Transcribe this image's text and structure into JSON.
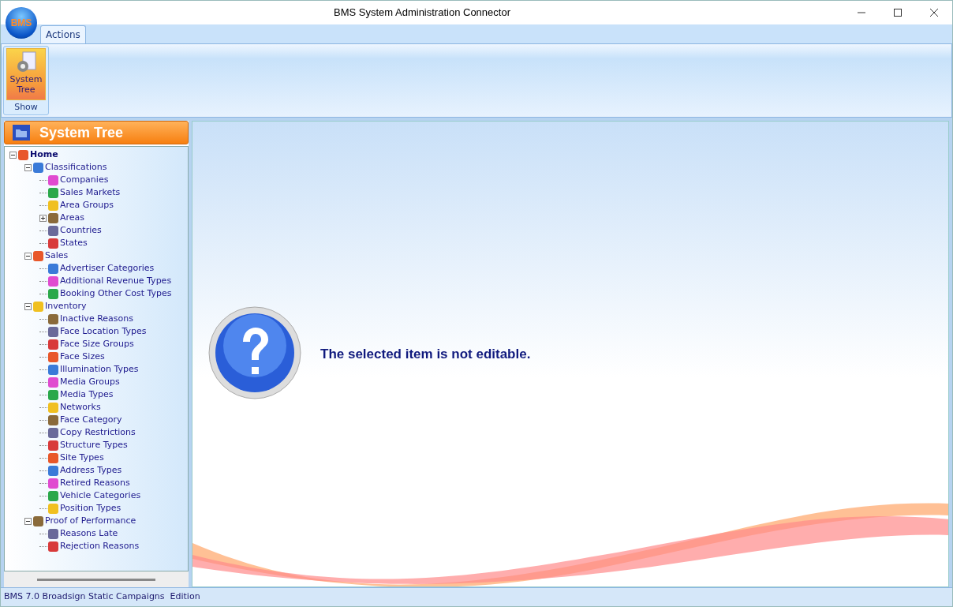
{
  "window": {
    "title": "BMS System Administration Connector",
    "logo": "BMS"
  },
  "ribbon": {
    "tabs": [
      {
        "label": "Actions",
        "selected": true
      }
    ],
    "groups": [
      {
        "label": "Show",
        "buttons": [
          {
            "label": "System Tree",
            "selected": true
          }
        ]
      }
    ]
  },
  "sidebar": {
    "title": "System Tree",
    "tree": [
      {
        "label": "Home",
        "expanded": true,
        "children": [
          {
            "label": "Classifications",
            "expanded": true,
            "children": [
              {
                "label": "Companies"
              },
              {
                "label": "Sales Markets"
              },
              {
                "label": "Area Groups"
              },
              {
                "label": "Areas",
                "expanded": false
              },
              {
                "label": "Countries"
              },
              {
                "label": "States"
              }
            ]
          },
          {
            "label": "Sales",
            "expanded": true,
            "children": [
              {
                "label": "Advertiser Categories"
              },
              {
                "label": "Additional Revenue Types"
              },
              {
                "label": "Booking Other Cost Types"
              }
            ]
          },
          {
            "label": "Inventory",
            "expanded": true,
            "children": [
              {
                "label": "Inactive Reasons"
              },
              {
                "label": "Face Location Types"
              },
              {
                "label": "Face Size Groups"
              },
              {
                "label": "Face Sizes"
              },
              {
                "label": "Illumination Types"
              },
              {
                "label": "Media Groups"
              },
              {
                "label": "Media Types"
              },
              {
                "label": "Networks"
              },
              {
                "label": "Face Category"
              },
              {
                "label": "Copy Restrictions"
              },
              {
                "label": "Structure Types"
              },
              {
                "label": "Site Types"
              },
              {
                "label": "Address Types"
              },
              {
                "label": "Retired Reasons"
              },
              {
                "label": "Vehicle Categories"
              },
              {
                "label": "Position Types"
              }
            ]
          },
          {
            "label": "Proof of Performance",
            "expanded": true,
            "children": [
              {
                "label": "Reasons Late"
              },
              {
                "label": "Rejection Reasons"
              }
            ]
          }
        ]
      }
    ]
  },
  "content": {
    "message": "The selected item is not editable."
  },
  "status_bar": {
    "text": "BMS 7.0 Broadsign Static Campaigns  Edition"
  }
}
